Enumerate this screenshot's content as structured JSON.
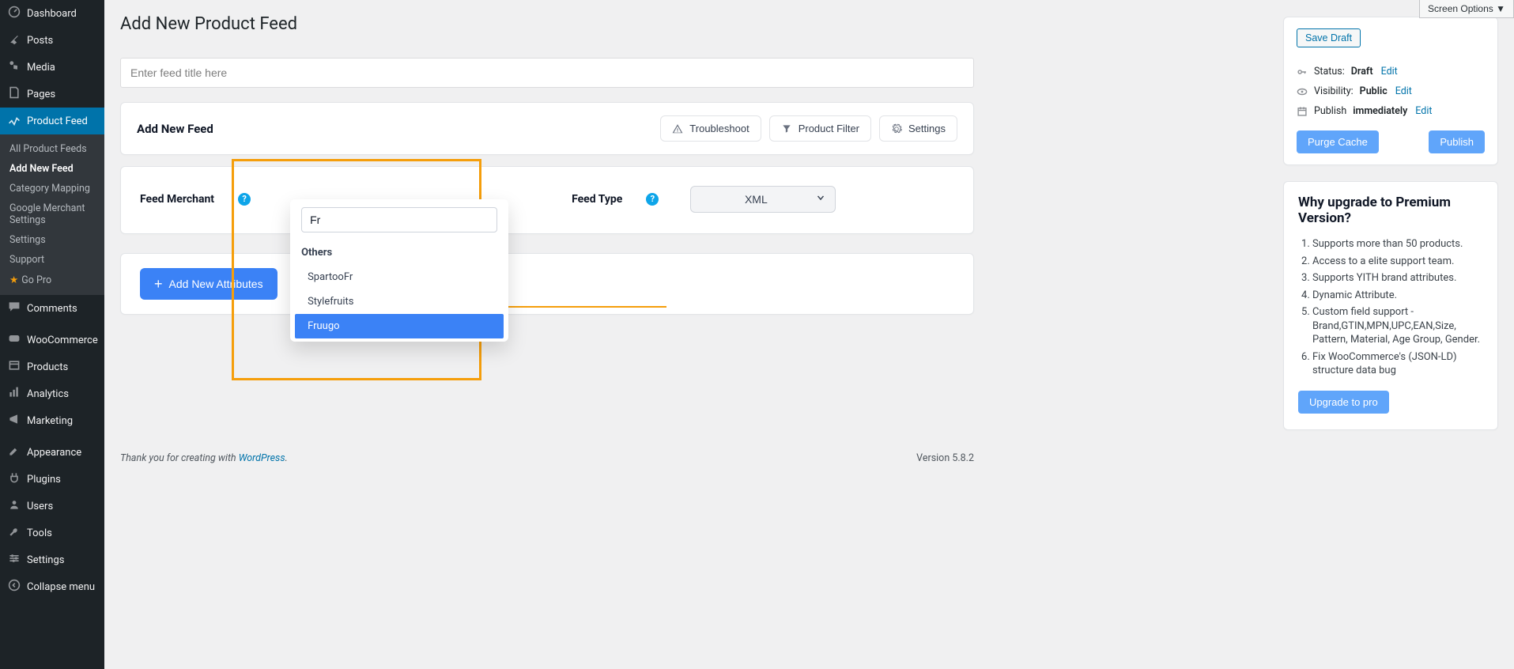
{
  "screen_options": "Screen Options",
  "sidebar": {
    "items": [
      {
        "icon": "dashboard",
        "label": "Dashboard"
      },
      {
        "icon": "pin",
        "label": "Posts"
      },
      {
        "icon": "media",
        "label": "Media"
      },
      {
        "icon": "page",
        "label": "Pages"
      },
      {
        "icon": "feed",
        "label": "Product Feed"
      },
      {
        "icon": "comment",
        "label": "Comments"
      },
      {
        "icon": "woo",
        "label": "WooCommerce"
      },
      {
        "icon": "products",
        "label": "Products"
      },
      {
        "icon": "analytics",
        "label": "Analytics"
      },
      {
        "icon": "marketing",
        "label": "Marketing"
      },
      {
        "icon": "appearance",
        "label": "Appearance"
      },
      {
        "icon": "plugins",
        "label": "Plugins"
      },
      {
        "icon": "users",
        "label": "Users"
      },
      {
        "icon": "tools",
        "label": "Tools"
      },
      {
        "icon": "settings",
        "label": "Settings"
      },
      {
        "icon": "collapse",
        "label": "Collapse menu"
      }
    ],
    "sub": [
      {
        "label": "All Product Feeds"
      },
      {
        "label": "Add New Feed"
      },
      {
        "label": "Category Mapping"
      },
      {
        "label": "Google Merchant Settings"
      },
      {
        "label": "Settings"
      },
      {
        "label": "Support"
      },
      {
        "label": "Go Pro",
        "star": true
      }
    ]
  },
  "page_title": "Add New Product Feed",
  "title_placeholder": "Enter feed title here",
  "addfeed": {
    "heading": "Add New Feed",
    "troubleshoot": "Troubleshoot",
    "product_filter": "Product Filter",
    "settings": "Settings"
  },
  "config": {
    "feed_merchant_label": "Feed Merchant",
    "feed_type_label": "Feed Type",
    "feed_type_value": "XML",
    "search_value": "Fr",
    "dd_section": "Others",
    "dd_items": [
      "SpartooFr",
      "Stylefruits",
      "Fruugo"
    ]
  },
  "add_attr": "Add New Attributes",
  "publish": {
    "save_draft": "Save Draft",
    "status_label": "Status:",
    "status_value": "Draft",
    "visibility_label": "Visibility:",
    "visibility_value": "Public",
    "publish_label": "Publish",
    "publish_value": "immediately",
    "edit": "Edit",
    "purge": "Purge Cache",
    "publish_btn": "Publish"
  },
  "upgrade": {
    "title": "Why upgrade to Premium Version?",
    "items": [
      "Supports more than 50 products.",
      "Access to a elite support team.",
      "Supports YITH brand attributes.",
      "Dynamic Attribute.",
      "Custom field support - Brand,GTIN,MPN,UPC,EAN,Size, Pattern, Material, Age Group, Gender.",
      "Fix WooCommerce's (JSON-LD) structure data bug"
    ],
    "cta": "Upgrade to pro"
  },
  "footer": {
    "thanks": "Thank you for creating with ",
    "wp": "WordPress",
    "period": ".",
    "version": "Version 5.8.2"
  }
}
